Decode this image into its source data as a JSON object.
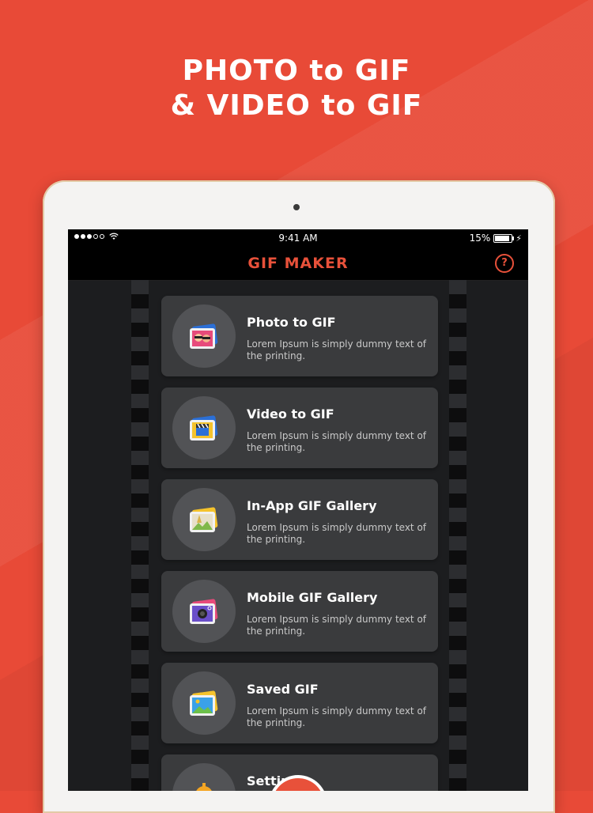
{
  "headline": {
    "line1": "PHOTO to GIF",
    "line2": "& VIDEO to GIF"
  },
  "statusbar": {
    "time": "9:41 AM",
    "battery": "15%"
  },
  "app": {
    "title": "GIF MAKER",
    "help": "?"
  },
  "menu": [
    {
      "title": "Photo to GIF",
      "desc": "Lorem Ipsum is simply dummy text of the printing.",
      "icon": "photo-collage-icon"
    },
    {
      "title": "Video to GIF",
      "desc": "Lorem Ipsum is simply dummy text of the printing.",
      "icon": "clapperboard-icon"
    },
    {
      "title": "In-App GIF Gallery",
      "desc": "Lorem Ipsum is simply dummy text of the printing.",
      "icon": "landscape-gallery-icon"
    },
    {
      "title": "Mobile GIF Gallery",
      "desc": "Lorem Ipsum is simply dummy text of the printing.",
      "icon": "camera-gallery-icon"
    },
    {
      "title": "Saved GIF",
      "desc": "Lorem Ipsum is simply dummy text of the printing.",
      "icon": "saved-image-icon"
    },
    {
      "title": "Settings",
      "desc": "",
      "icon": "gear-icon"
    }
  ],
  "colors": {
    "brand": "#e8513a",
    "background": "#e84a37",
    "screen": "#1c1d1f",
    "card": "#3a3b3d"
  }
}
